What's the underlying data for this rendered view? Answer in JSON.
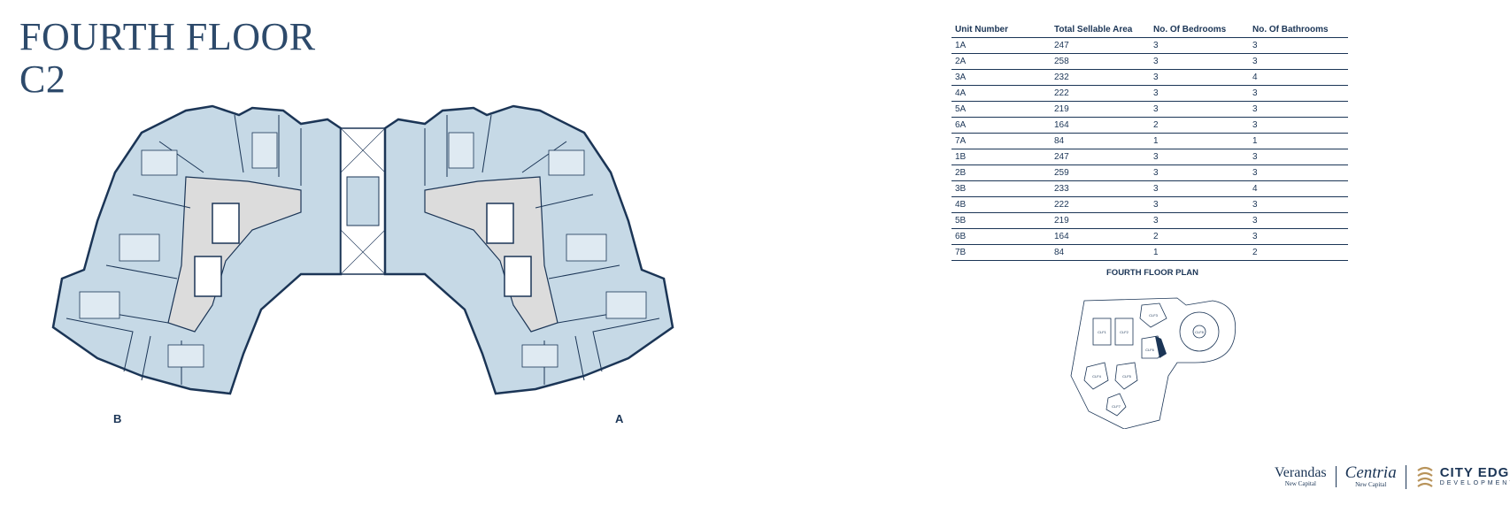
{
  "title": {
    "line1": "FOURTH FLOOR",
    "line2": "C2"
  },
  "wings": {
    "left": "B",
    "right": "A"
  },
  "table": {
    "headers": [
      "Unit Number",
      "Total Sellable Area",
      "No. Of Bedrooms",
      "No. Of Bathrooms"
    ],
    "rows": [
      [
        "1A",
        "247",
        "3",
        "3"
      ],
      [
        "2A",
        "258",
        "3",
        "3"
      ],
      [
        "3A",
        "232",
        "3",
        "4"
      ],
      [
        "4A",
        "222",
        "3",
        "3"
      ],
      [
        "5A",
        "219",
        "3",
        "3"
      ],
      [
        "6A",
        "164",
        "2",
        "3"
      ],
      [
        "7A",
        "84",
        "1",
        "1"
      ],
      [
        "1B",
        "247",
        "3",
        "3"
      ],
      [
        "2B",
        "259",
        "3",
        "3"
      ],
      [
        "3B",
        "233",
        "3",
        "4"
      ],
      [
        "4B",
        "222",
        "3",
        "3"
      ],
      [
        "5B",
        "219",
        "3",
        "3"
      ],
      [
        "6B",
        "164",
        "2",
        "3"
      ],
      [
        "7B",
        "84",
        "1",
        "2"
      ]
    ]
  },
  "keyplan": {
    "title": "FOURTH FLOOR PLAN",
    "building_labels": [
      "CLF1",
      "CLF2",
      "CLF3",
      "CLF4",
      "CLF5",
      "CLF6",
      "CLF7",
      "CLF8"
    ]
  },
  "logos": {
    "verandas": "Verandas",
    "verandas_sub": "New Capital",
    "centria": "Centria",
    "centria_sub": "New Capital",
    "cityedge": "CITY EDGE",
    "cityedge_sub": "DEVELOPMENTS"
  },
  "colors": {
    "navy": "#1b3556",
    "unit_blue": "#a9c4d8",
    "unit_light": "#d7e5ef",
    "core_grey": "#dcdcdc"
  }
}
